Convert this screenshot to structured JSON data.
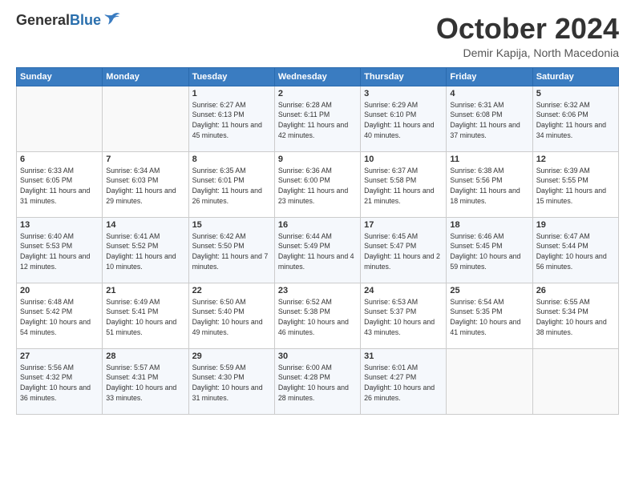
{
  "header": {
    "logo_general": "General",
    "logo_blue": "Blue",
    "month_title": "October 2024",
    "subtitle": "Demir Kapija, North Macedonia"
  },
  "days_of_week": [
    "Sunday",
    "Monday",
    "Tuesday",
    "Wednesday",
    "Thursday",
    "Friday",
    "Saturday"
  ],
  "weeks": [
    [
      {
        "day": "",
        "info": ""
      },
      {
        "day": "",
        "info": ""
      },
      {
        "day": "1",
        "info": "Sunrise: 6:27 AM\nSunset: 6:13 PM\nDaylight: 11 hours and 45 minutes."
      },
      {
        "day": "2",
        "info": "Sunrise: 6:28 AM\nSunset: 6:11 PM\nDaylight: 11 hours and 42 minutes."
      },
      {
        "day": "3",
        "info": "Sunrise: 6:29 AM\nSunset: 6:10 PM\nDaylight: 11 hours and 40 minutes."
      },
      {
        "day": "4",
        "info": "Sunrise: 6:31 AM\nSunset: 6:08 PM\nDaylight: 11 hours and 37 minutes."
      },
      {
        "day": "5",
        "info": "Sunrise: 6:32 AM\nSunset: 6:06 PM\nDaylight: 11 hours and 34 minutes."
      }
    ],
    [
      {
        "day": "6",
        "info": "Sunrise: 6:33 AM\nSunset: 6:05 PM\nDaylight: 11 hours and 31 minutes."
      },
      {
        "day": "7",
        "info": "Sunrise: 6:34 AM\nSunset: 6:03 PM\nDaylight: 11 hours and 29 minutes."
      },
      {
        "day": "8",
        "info": "Sunrise: 6:35 AM\nSunset: 6:01 PM\nDaylight: 11 hours and 26 minutes."
      },
      {
        "day": "9",
        "info": "Sunrise: 6:36 AM\nSunset: 6:00 PM\nDaylight: 11 hours and 23 minutes."
      },
      {
        "day": "10",
        "info": "Sunrise: 6:37 AM\nSunset: 5:58 PM\nDaylight: 11 hours and 21 minutes."
      },
      {
        "day": "11",
        "info": "Sunrise: 6:38 AM\nSunset: 5:56 PM\nDaylight: 11 hours and 18 minutes."
      },
      {
        "day": "12",
        "info": "Sunrise: 6:39 AM\nSunset: 5:55 PM\nDaylight: 11 hours and 15 minutes."
      }
    ],
    [
      {
        "day": "13",
        "info": "Sunrise: 6:40 AM\nSunset: 5:53 PM\nDaylight: 11 hours and 12 minutes."
      },
      {
        "day": "14",
        "info": "Sunrise: 6:41 AM\nSunset: 5:52 PM\nDaylight: 11 hours and 10 minutes."
      },
      {
        "day": "15",
        "info": "Sunrise: 6:42 AM\nSunset: 5:50 PM\nDaylight: 11 hours and 7 minutes."
      },
      {
        "day": "16",
        "info": "Sunrise: 6:44 AM\nSunset: 5:49 PM\nDaylight: 11 hours and 4 minutes."
      },
      {
        "day": "17",
        "info": "Sunrise: 6:45 AM\nSunset: 5:47 PM\nDaylight: 11 hours and 2 minutes."
      },
      {
        "day": "18",
        "info": "Sunrise: 6:46 AM\nSunset: 5:45 PM\nDaylight: 10 hours and 59 minutes."
      },
      {
        "day": "19",
        "info": "Sunrise: 6:47 AM\nSunset: 5:44 PM\nDaylight: 10 hours and 56 minutes."
      }
    ],
    [
      {
        "day": "20",
        "info": "Sunrise: 6:48 AM\nSunset: 5:42 PM\nDaylight: 10 hours and 54 minutes."
      },
      {
        "day": "21",
        "info": "Sunrise: 6:49 AM\nSunset: 5:41 PM\nDaylight: 10 hours and 51 minutes."
      },
      {
        "day": "22",
        "info": "Sunrise: 6:50 AM\nSunset: 5:40 PM\nDaylight: 10 hours and 49 minutes."
      },
      {
        "day": "23",
        "info": "Sunrise: 6:52 AM\nSunset: 5:38 PM\nDaylight: 10 hours and 46 minutes."
      },
      {
        "day": "24",
        "info": "Sunrise: 6:53 AM\nSunset: 5:37 PM\nDaylight: 10 hours and 43 minutes."
      },
      {
        "day": "25",
        "info": "Sunrise: 6:54 AM\nSunset: 5:35 PM\nDaylight: 10 hours and 41 minutes."
      },
      {
        "day": "26",
        "info": "Sunrise: 6:55 AM\nSunset: 5:34 PM\nDaylight: 10 hours and 38 minutes."
      }
    ],
    [
      {
        "day": "27",
        "info": "Sunrise: 5:56 AM\nSunset: 4:32 PM\nDaylight: 10 hours and 36 minutes."
      },
      {
        "day": "28",
        "info": "Sunrise: 5:57 AM\nSunset: 4:31 PM\nDaylight: 10 hours and 33 minutes."
      },
      {
        "day": "29",
        "info": "Sunrise: 5:59 AM\nSunset: 4:30 PM\nDaylight: 10 hours and 31 minutes."
      },
      {
        "day": "30",
        "info": "Sunrise: 6:00 AM\nSunset: 4:28 PM\nDaylight: 10 hours and 28 minutes."
      },
      {
        "day": "31",
        "info": "Sunrise: 6:01 AM\nSunset: 4:27 PM\nDaylight: 10 hours and 26 minutes."
      },
      {
        "day": "",
        "info": ""
      },
      {
        "day": "",
        "info": ""
      }
    ]
  ]
}
